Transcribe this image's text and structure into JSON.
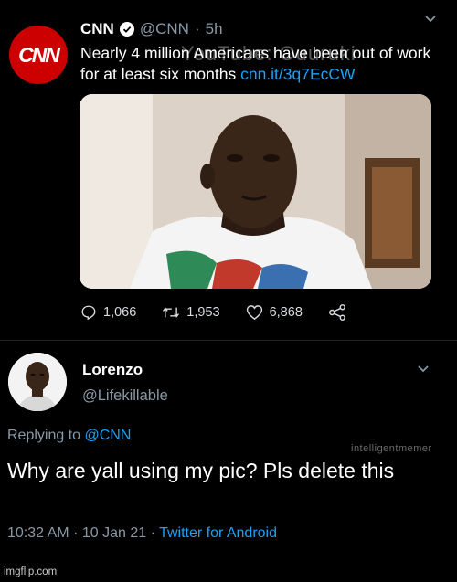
{
  "tweet_cnn": {
    "avatar_text": "CNN",
    "display_name": "CNN",
    "handle": "@CNN",
    "separator": "·",
    "time": "5h",
    "text": "Nearly 4 million Americans have been out of work for at least six months",
    "link": "cnn.it/3q7EcCW",
    "image_watermark": "YouTube: Ouuruki",
    "stats": {
      "replies": "1,066",
      "retweets": "1,953",
      "likes": "6,868"
    },
    "icons": {
      "verified": "verified-badge-icon",
      "menu": "chevron-down-icon",
      "reply": "reply-icon",
      "retweet": "retweet-icon",
      "like": "heart-icon",
      "share": "share-icon"
    }
  },
  "tweet_reply": {
    "display_name": "Lorenzo",
    "handle": "@Lifekillable",
    "replying_prefix": "Replying to",
    "replying_to": "@CNN",
    "text": "Why are yall using my pic? Pls delete this",
    "time": "10:32 AM",
    "date": "10 Jan 21",
    "separator": "·",
    "source": "Twitter for Android"
  },
  "watermarks": {
    "intel": "intelligentmemer",
    "imgflip": "imgflip.com"
  },
  "colors": {
    "background": "#000000",
    "link_blue": "#1da1f2",
    "secondary_grey": "#8899a6",
    "cnn_red": "#cc0000"
  }
}
